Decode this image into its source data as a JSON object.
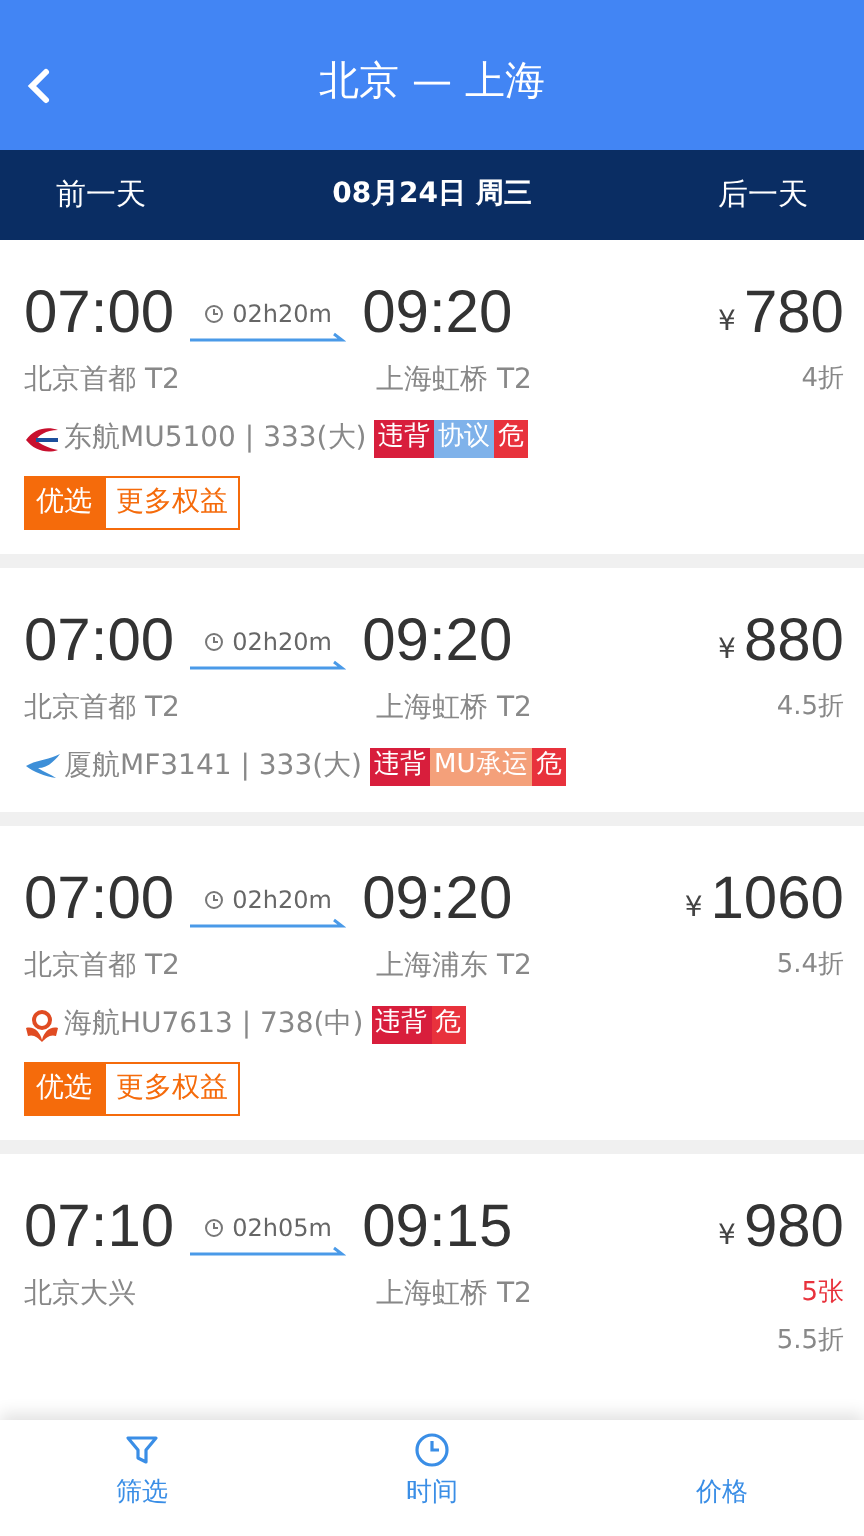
{
  "header": {
    "title": "北京 — 上海"
  },
  "date_bar": {
    "prev": "前一天",
    "date": "08月24日 周三",
    "next": "后一天"
  },
  "flights": [
    {
      "depart_time": "07:00",
      "duration": "02h20m",
      "arrive_time": "09:20",
      "depart_airport": "北京首都 T2",
      "arrive_airport": "上海虹桥 T2",
      "currency": "¥",
      "price": "780",
      "discount": "4折",
      "flight": "东航MU5100 | 333(大)",
      "tags": [
        {
          "text": "违背",
          "color": "#d81e3c"
        },
        {
          "text": "协议",
          "color": "#7fb2ea"
        },
        {
          "text": "危",
          "color": "#e8323c"
        }
      ],
      "badges": [
        "优选",
        "更多权益"
      ]
    },
    {
      "depart_time": "07:00",
      "duration": "02h20m",
      "arrive_time": "09:20",
      "depart_airport": "北京首都 T2",
      "arrive_airport": "上海虹桥 T2",
      "currency": "¥",
      "price": "880",
      "discount": "4.5折",
      "flight": "厦航MF3141 | 333(大)",
      "tags": [
        {
          "text": "违背",
          "color": "#d81e3c"
        },
        {
          "text": "MU承运",
          "color": "#f4a07a"
        },
        {
          "text": "危",
          "color": "#e8323c"
        }
      ]
    },
    {
      "depart_time": "07:00",
      "duration": "02h20m",
      "arrive_time": "09:20",
      "depart_airport": "北京首都 T2",
      "arrive_airport": "上海浦东 T2",
      "currency": "¥",
      "price": "1060",
      "discount": "5.4折",
      "flight": "海航HU7613 | 738(中)",
      "tags": [
        {
          "text": "违背",
          "color": "#d81e3c"
        },
        {
          "text": "危",
          "color": "#e8323c"
        }
      ],
      "badges": [
        "优选",
        "更多权益"
      ]
    },
    {
      "depart_time": "07:10",
      "duration": "02h05m",
      "arrive_time": "09:15",
      "depart_airport": "北京大兴",
      "arrive_airport": "上海虹桥 T2",
      "currency": "¥",
      "price": "980",
      "seats": "5张",
      "discount": "5.5折"
    }
  ],
  "bottom_bar": [
    {
      "label": "筛选"
    },
    {
      "label": "时间"
    },
    {
      "label": "价格"
    }
  ]
}
